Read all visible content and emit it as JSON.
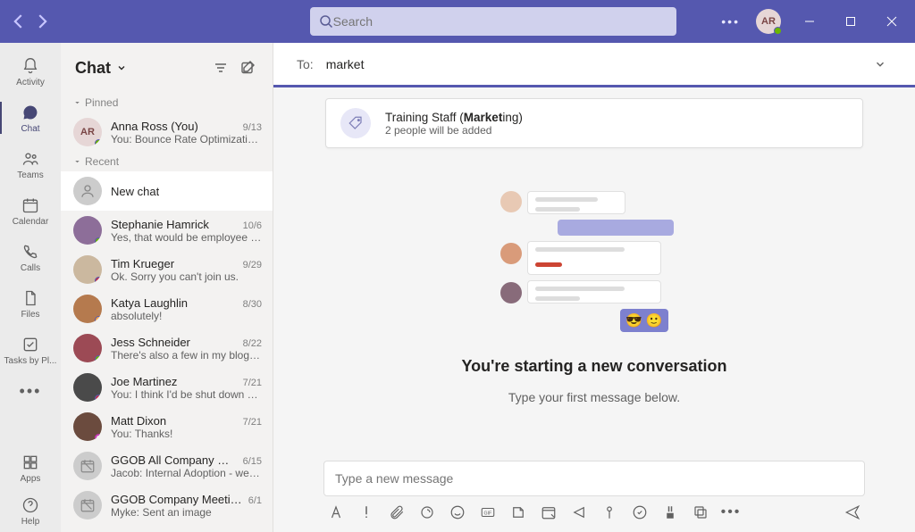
{
  "titlebar": {
    "search_placeholder": "Search",
    "user_initials": "AR",
    "presence": "available"
  },
  "rail": {
    "items": [
      {
        "id": "activity",
        "label": "Activity"
      },
      {
        "id": "chat",
        "label": "Chat"
      },
      {
        "id": "teams",
        "label": "Teams"
      },
      {
        "id": "calendar",
        "label": "Calendar"
      },
      {
        "id": "calls",
        "label": "Calls"
      },
      {
        "id": "files",
        "label": "Files"
      },
      {
        "id": "tasks",
        "label": "Tasks by Pl..."
      }
    ],
    "apps_label": "Apps",
    "help_label": "Help",
    "selected": "chat"
  },
  "chatlist": {
    "title": "Chat",
    "pinned_label": "Pinned",
    "recent_label": "Recent",
    "pinned": [
      {
        "name": "Anna Ross (You)",
        "ts": "9/13",
        "preview": "You: Bounce Rate Optimization_Tr...",
        "initials": "AR",
        "presence": "green",
        "avatar_bg": "#e6d6d6",
        "avatar_fg": "#7a4545"
      }
    ],
    "newchat_label": "New chat",
    "recent": [
      {
        "name": "Stephanie Hamrick",
        "ts": "10/6",
        "preview": "Yes, that would be employee refe...",
        "presence": "green",
        "avatar_bg": "#8d6e99"
      },
      {
        "name": "Tim Krueger",
        "ts": "9/29",
        "preview": "Ok. Sorry you can't join us.",
        "presence": "red",
        "avatar_bg": "#cbb89f"
      },
      {
        "name": "Katya Laughlin",
        "ts": "8/30",
        "preview": "absolutely!",
        "presence": "yellow",
        "avatar_bg": "#b57a4e"
      },
      {
        "name": "Jess Schneider",
        "ts": "8/22",
        "preview": "There's also a few in my blog abo...",
        "presence": "green",
        "avatar_bg": "#9c4a55"
      },
      {
        "name": "Joe Martinez",
        "ts": "7/21",
        "preview": "You: I think I'd be shut down befo...",
        "presence": "red",
        "avatar_bg": "#4a4a4a"
      },
      {
        "name": "Matt Dixon",
        "ts": "7/21",
        "preview": "You: Thanks!",
        "presence": "pink",
        "avatar_bg": "#6b4b3e"
      },
      {
        "name": "GGOB All Company Meeti...",
        "ts": "6/15",
        "preview": "Jacob: Internal Adoption - we hav...",
        "meeting": true
      },
      {
        "name": "GGOB Company Meeting",
        "ts": "6/1",
        "preview": "Myke: Sent an image",
        "meeting": true
      }
    ]
  },
  "conversation": {
    "to_label": "To:",
    "to_value": "market",
    "suggestion": {
      "title_pre": "Training Staff (",
      "title_bold": "Market",
      "title_post": "ing)",
      "subtitle": "2 people will be added"
    },
    "empty_title": "You're starting a new conversation",
    "empty_sub": "Type your first message below.",
    "compose_placeholder": "Type a new message"
  }
}
